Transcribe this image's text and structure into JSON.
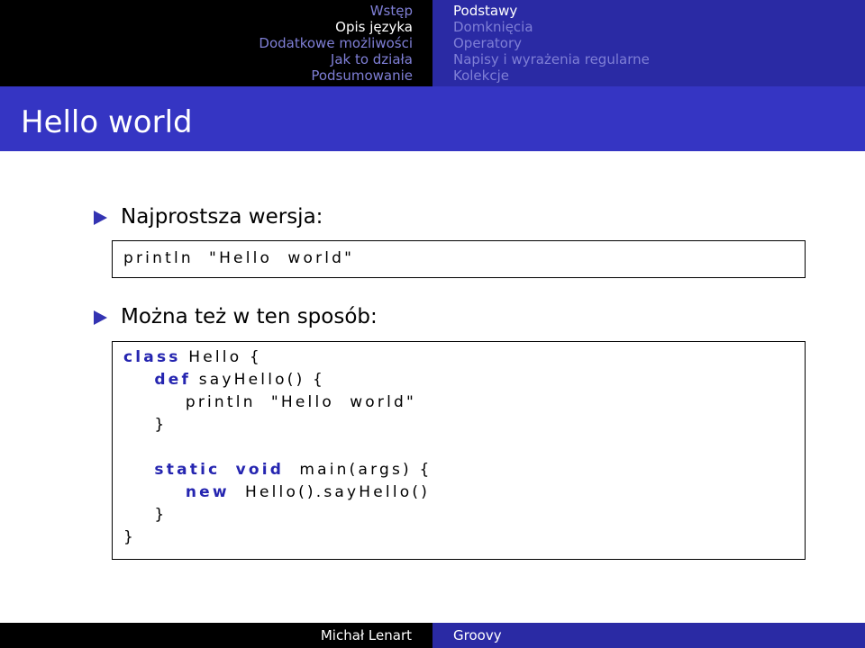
{
  "nav": {
    "sections": [
      {
        "label": "Wstęp",
        "active": false
      },
      {
        "label": "Opis języka",
        "active": true
      },
      {
        "label": "Dodatkowe możliwości",
        "active": false
      },
      {
        "label": "Jak to działa",
        "active": false
      },
      {
        "label": "Podsumowanie",
        "active": false
      }
    ],
    "subsections": [
      {
        "label": "Podstawy",
        "active": true
      },
      {
        "label": "Domknięcia",
        "active": false
      },
      {
        "label": "Operatory",
        "active": false
      },
      {
        "label": "Napisy i wyrażenia regularne",
        "active": false
      },
      {
        "label": "Kolekcje",
        "active": false
      }
    ]
  },
  "slide": {
    "title": "Hello world",
    "items": [
      {
        "text": "Najprostsza wersja:",
        "code": [
          [
            {
              "t": "println  \"Hello  world\"",
              "kw": false
            }
          ]
        ]
      },
      {
        "text": "Można też w ten sposób:",
        "code": [
          [
            {
              "t": "class",
              "kw": true
            },
            {
              "t": " Hello {",
              "kw": false
            }
          ],
          [
            {
              "t": "    ",
              "kw": false
            },
            {
              "t": "def",
              "kw": true
            },
            {
              "t": " sayHello() {",
              "kw": false
            }
          ],
          [
            {
              "t": "        println  \"Hello  world\"",
              "kw": false
            }
          ],
          [
            {
              "t": "    }",
              "kw": false
            }
          ],
          [
            {
              "t": "",
              "kw": false
            }
          ],
          [
            {
              "t": "    ",
              "kw": false
            },
            {
              "t": "static",
              "kw": true
            },
            {
              "t": "  ",
              "kw": false
            },
            {
              "t": "void",
              "kw": true
            },
            {
              "t": "  main(args) {",
              "kw": false
            }
          ],
          [
            {
              "t": "        ",
              "kw": false
            },
            {
              "t": "new",
              "kw": true
            },
            {
              "t": "  Hello().sayHello()",
              "kw": false
            }
          ],
          [
            {
              "t": "    }",
              "kw": false
            }
          ],
          [
            {
              "t": "}",
              "kw": false
            }
          ]
        ]
      }
    ]
  },
  "footer": {
    "author": "Michał Lenart",
    "talk": "Groovy"
  },
  "colors": {
    "nav_left_bg": "#000000",
    "nav_right_bg": "#2a2aa4",
    "title_bg": "#3535c3",
    "inactive_text": "#7f7fd6",
    "keyword": "#2525b0",
    "bullet": "#3333b2"
  }
}
